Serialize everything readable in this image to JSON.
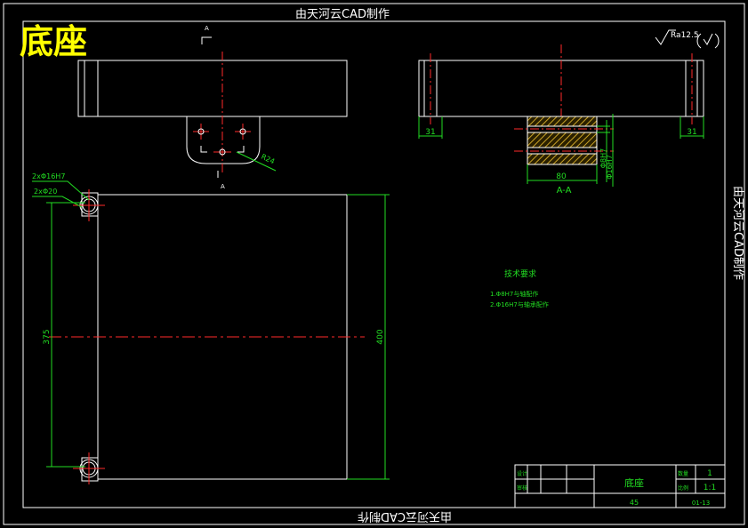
{
  "header_watermark": "由天河云CAD制作",
  "side_watermark": "由天河云CAD制作",
  "bottom_watermark": "由天河云CAD制作",
  "big_title": "底座",
  "roughness": "Ra12.5",
  "section_mark_top": "A",
  "section_mark_bottom": "A",
  "dims": {
    "r24": "R24",
    "left31": "31",
    "right31": "31",
    "w80": "80",
    "d8": "Φ8H7",
    "d16": "Φ16H7",
    "section_label": "A-A",
    "hole16": "2xΦ16H7",
    "hole20": "2xΦ20",
    "h375": "375",
    "h400": "400"
  },
  "notes": {
    "title": "技术要求",
    "line1": "1.Φ8H7与轴配作",
    "line2": "2.Φ16H7与轴承配作"
  },
  "title_block": {
    "designer_label": "设计",
    "checker_label": "审核",
    "part_name": "底座",
    "qty_label": "数量",
    "qty_value": "1",
    "scale_label": "比例",
    "scale_value": "1:1",
    "material": "45",
    "drawing_no": "01-13"
  },
  "colors": {
    "outline": "#ffffff",
    "center": "#ff2a2a",
    "dim": "#22dd22",
    "title": "#ffff00",
    "hatch": "#c9a227"
  }
}
